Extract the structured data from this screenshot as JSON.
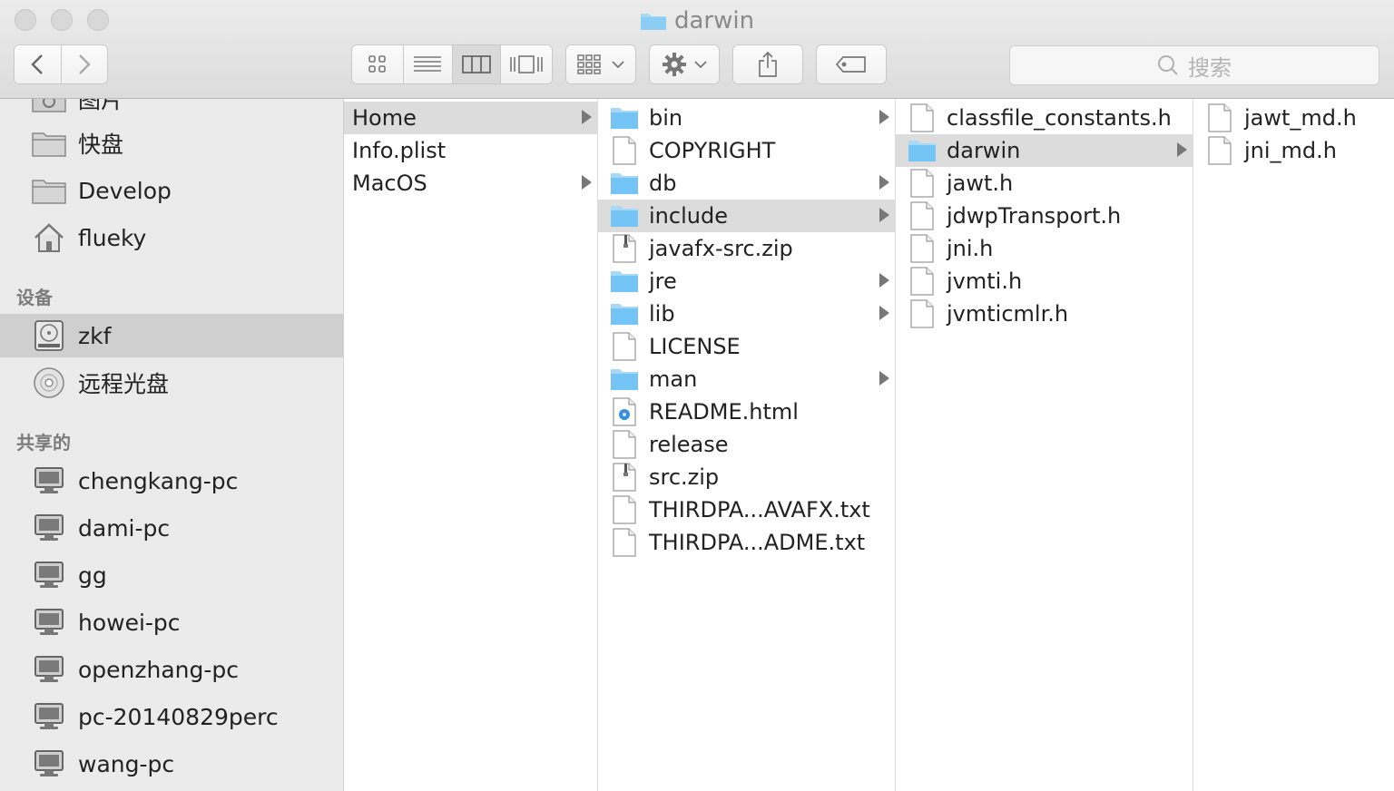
{
  "window": {
    "title": "darwin"
  },
  "toolbar": {
    "back": "back",
    "forward": "forward",
    "view_modes": [
      "icon-view",
      "list-view",
      "column-view",
      "cover-flow-view"
    ],
    "arrange": "arrange",
    "action": "action",
    "share": "share",
    "tags": "tags",
    "search_placeholder": "搜索"
  },
  "sidebar": {
    "favorites": [
      {
        "label": "图片",
        "icon": "picture-folder-icon"
      },
      {
        "label": "快盘",
        "icon": "folder-icon"
      },
      {
        "label": "Develop",
        "icon": "folder-icon"
      },
      {
        "label": "flueky",
        "icon": "home-icon"
      }
    ],
    "devices_header": "设备",
    "devices": [
      {
        "label": "zkf",
        "icon": "hard-drive-icon",
        "selected": true
      },
      {
        "label": "远程光盘",
        "icon": "optical-disc-icon"
      }
    ],
    "shared_header": "共享的",
    "shared": [
      {
        "label": "chengkang-pc",
        "icon": "computer-icon"
      },
      {
        "label": "dami-pc",
        "icon": "computer-icon"
      },
      {
        "label": "gg",
        "icon": "computer-icon"
      },
      {
        "label": "howei-pc",
        "icon": "computer-icon"
      },
      {
        "label": "openzhang-pc",
        "icon": "computer-icon"
      },
      {
        "label": "pc-20140829perc",
        "icon": "computer-icon"
      },
      {
        "label": "wang-pc",
        "icon": "computer-icon"
      }
    ]
  },
  "columns": [
    {
      "items": [
        {
          "name": "Home",
          "type": "plain",
          "folder": true,
          "selected": true
        },
        {
          "name": "Info.plist",
          "type": "plain"
        },
        {
          "name": "MacOS",
          "type": "plain",
          "folder": true
        }
      ]
    },
    {
      "items": [
        {
          "name": "bin",
          "type": "folder"
        },
        {
          "name": "COPYRIGHT",
          "type": "file"
        },
        {
          "name": "db",
          "type": "folder"
        },
        {
          "name": "include",
          "type": "folder",
          "selected": true
        },
        {
          "name": "javafx-src.zip",
          "type": "zip"
        },
        {
          "name": "jre",
          "type": "folder"
        },
        {
          "name": "lib",
          "type": "folder"
        },
        {
          "name": "LICENSE",
          "type": "file"
        },
        {
          "name": "man",
          "type": "folder"
        },
        {
          "name": "README.html",
          "type": "html"
        },
        {
          "name": "release",
          "type": "file"
        },
        {
          "name": "src.zip",
          "type": "zip"
        },
        {
          "name": "THIRDPA...AVAFX.txt",
          "type": "file"
        },
        {
          "name": "THIRDPA...ADME.txt",
          "type": "file"
        }
      ]
    },
    {
      "items": [
        {
          "name": "classfile_constants.h",
          "type": "file"
        },
        {
          "name": "darwin",
          "type": "folder",
          "selected": true
        },
        {
          "name": "jawt.h",
          "type": "file"
        },
        {
          "name": "jdwpTransport.h",
          "type": "file"
        },
        {
          "name": "jni.h",
          "type": "file"
        },
        {
          "name": "jvmti.h",
          "type": "file"
        },
        {
          "name": "jvmticmlr.h",
          "type": "file"
        }
      ]
    },
    {
      "items": [
        {
          "name": "jawt_md.h",
          "type": "file"
        },
        {
          "name": "jni_md.h",
          "type": "file"
        }
      ]
    }
  ],
  "colors": {
    "folder": "#74c5f5",
    "selection": "#dcdcdc",
    "sidebar_selection": "#cfcfcf"
  }
}
